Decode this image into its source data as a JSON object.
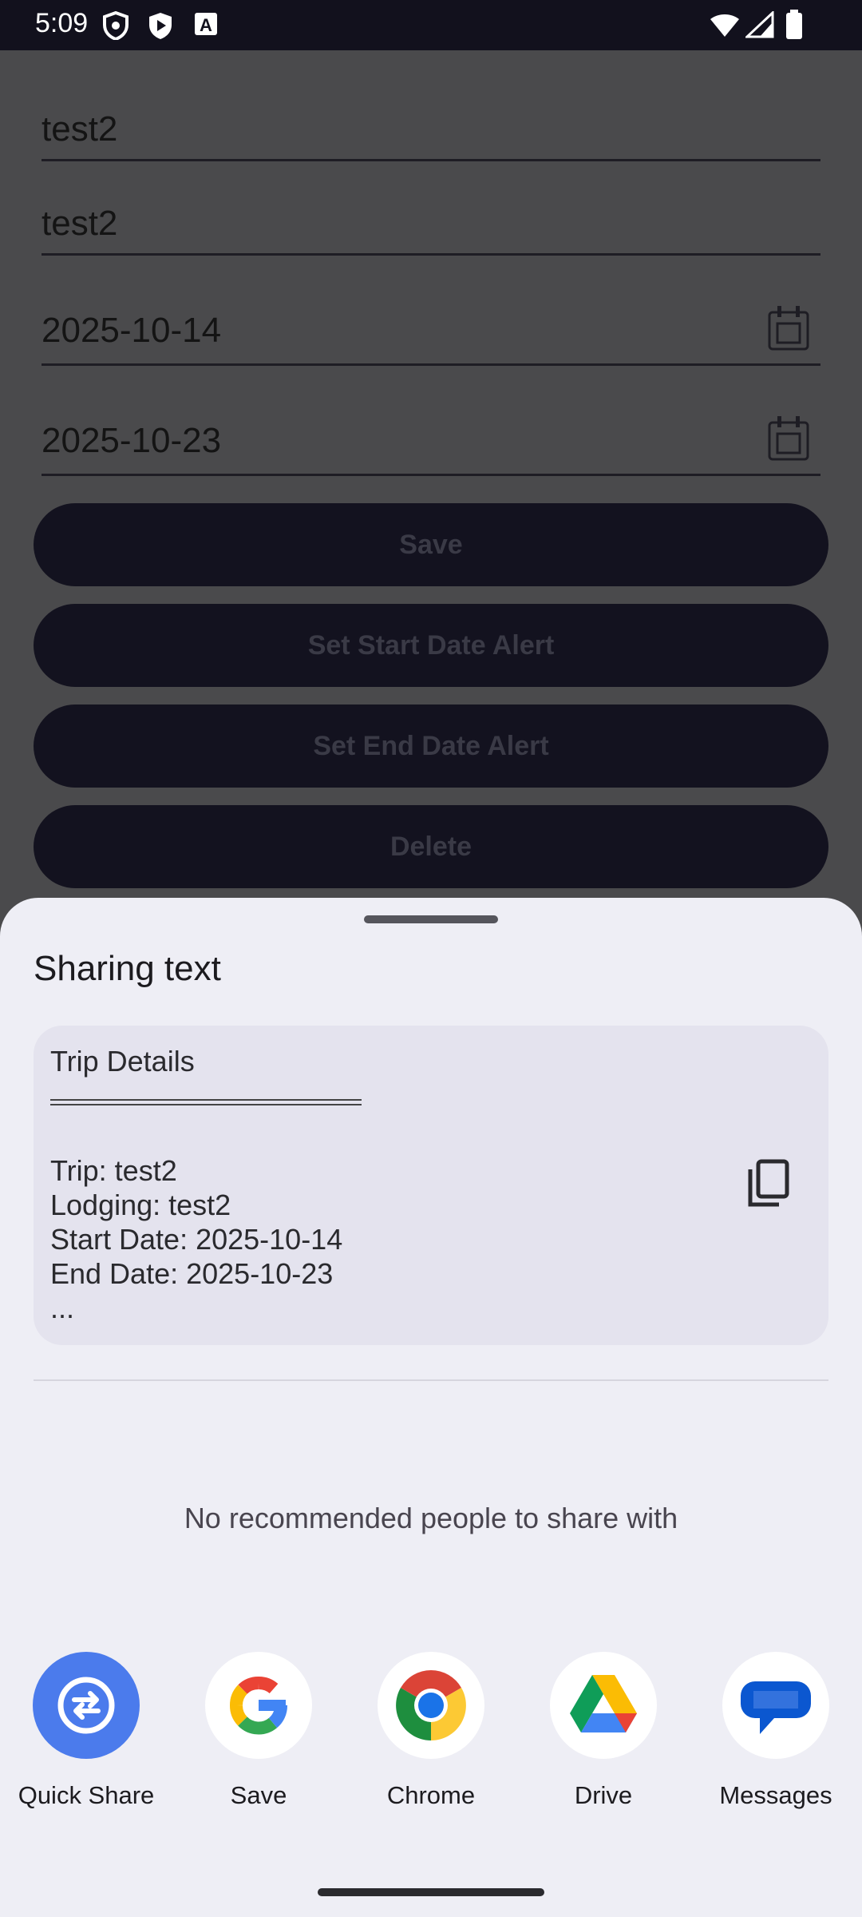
{
  "status_bar": {
    "time": "5:09"
  },
  "form": {
    "trip": "test2",
    "lodging": "test2",
    "start_date": "2025-10-14",
    "end_date": "2025-10-23",
    "save_label": "Save",
    "start_alert_label": "Set Start Date Alert",
    "end_alert_label": "Set End Date Alert",
    "delete_label": "Delete"
  },
  "sheet": {
    "title": "Sharing text",
    "preview": {
      "title": "Trip Details",
      "lines": [
        "Trip: test2",
        "Lodging: test2",
        "Start Date: 2025-10-14",
        "End Date: 2025-10-23",
        "..."
      ]
    },
    "no_recommendations": "No recommended people to share with",
    "targets": [
      {
        "label": "Quick Share",
        "icon": "quick-share-icon"
      },
      {
        "label": "Save",
        "icon": "google-icon"
      },
      {
        "label": "Chrome",
        "icon": "chrome-icon"
      },
      {
        "label": "Drive",
        "icon": "drive-icon"
      },
      {
        "label": "Messages",
        "icon": "messages-icon"
      }
    ]
  },
  "colors": {
    "accent": "#4b7bec",
    "sheet_bg": "#eeeef5",
    "button_bg": "#13121f"
  }
}
